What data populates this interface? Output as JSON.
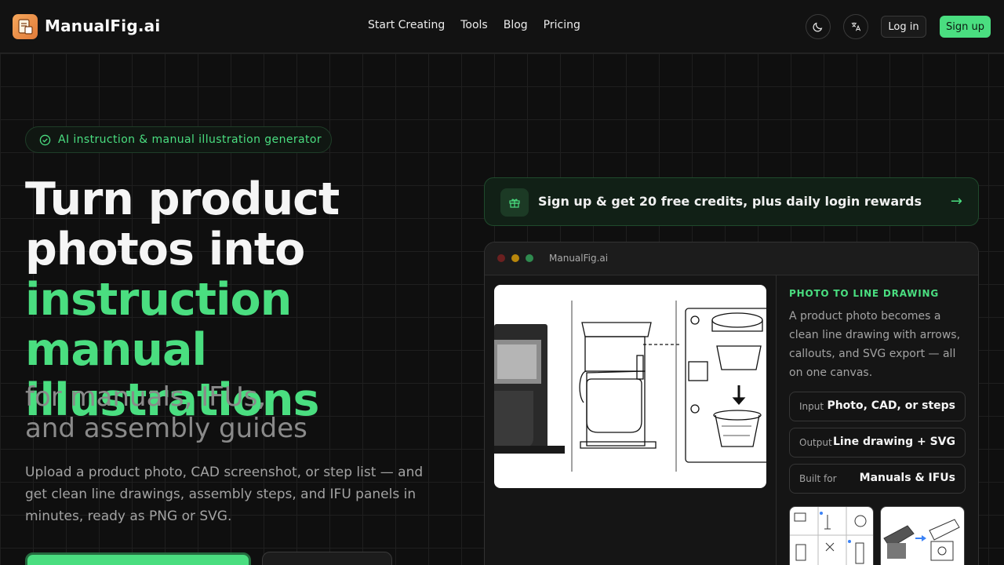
{
  "nav": {
    "brand": "ManualFig.ai",
    "links": [
      "Start Creating",
      "Tools",
      "Blog",
      "Pricing"
    ],
    "login_label": "Log in",
    "signup_label": "Sign up",
    "theme_icon": "moon-icon",
    "language_icon": "translate-icon"
  },
  "hero": {
    "badge": "AI instruction & manual illustration generator",
    "headline_1": "Turn product",
    "headline_2": "photos into",
    "headline_accent_1": "instruction manual",
    "headline_accent_2": "illustrations",
    "sub_1": "for manuals, IFUs,",
    "sub_2": "and assembly guides",
    "lead": "Upload a product photo, CAD screenshot, or step list — and get clean line drawings, assembly steps, and IFU panels in minutes, ready as PNG or SVG."
  },
  "promo": {
    "text": "Sign up & get 20 free credits, plus daily login rewards",
    "icon": "gift-icon"
  },
  "app_card": {
    "title": "ManualFig.ai",
    "panel_label": "PHOTO TO LINE DRAWING",
    "panel_desc": "A product photo becomes a clean line drawing with arrows, callouts, and SVG export — all on one canvas.",
    "rows": [
      {
        "key": "Input",
        "value": "Photo, CAD, or steps"
      },
      {
        "key": "Output",
        "value": "Line drawing + SVG"
      },
      {
        "key": "Built for",
        "value": "Manuals & IFUs"
      }
    ]
  },
  "colors": {
    "accent": "#4ade80",
    "background": "#0f0f0f",
    "muted_text": "#a3a3a3"
  }
}
